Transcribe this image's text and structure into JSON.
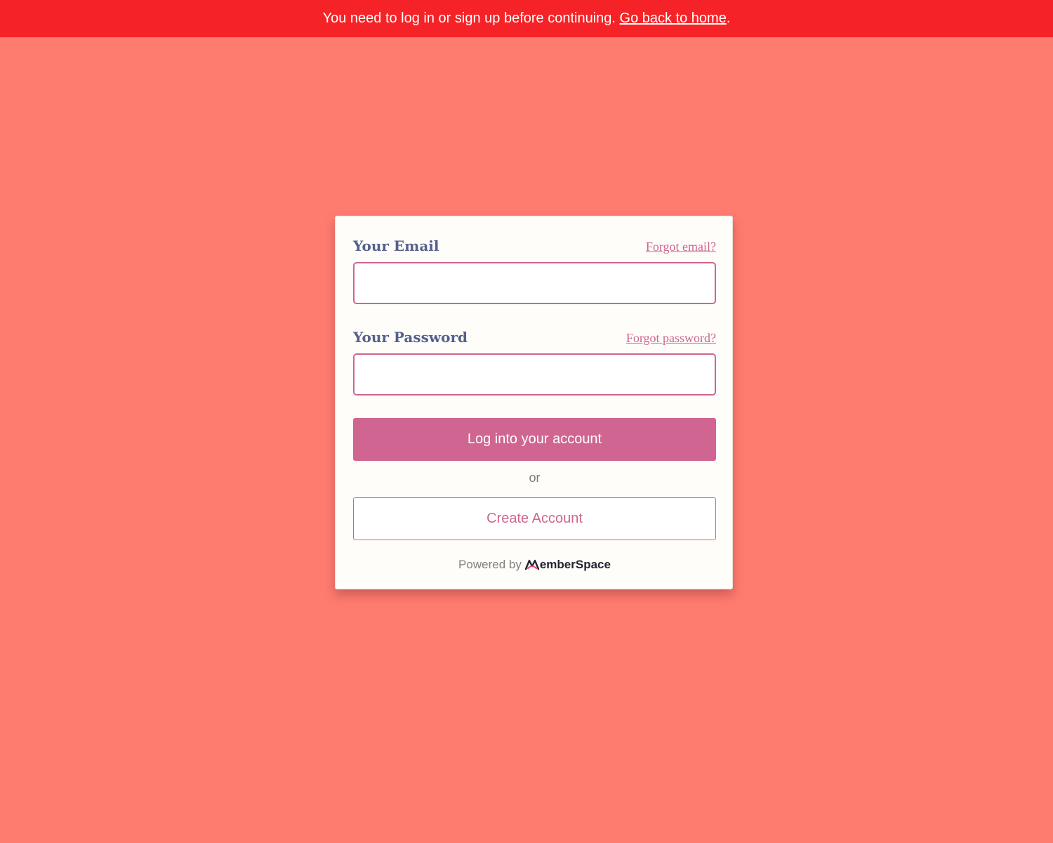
{
  "banner": {
    "message": "You need to log in or sign up before continuing.",
    "link_label": "Go back to home",
    "trailing": "."
  },
  "form": {
    "email": {
      "label": "Your Email",
      "forgot_label": "Forgot email?",
      "value": ""
    },
    "password": {
      "label": "Your Password",
      "forgot_label": "Forgot password?",
      "value": ""
    },
    "login_label": "Log into your account",
    "or_label": "or",
    "create_label": "Create Account"
  },
  "footer": {
    "powered_label": "Powered by",
    "brand_name": "emberSpace",
    "brand_icon": "memberspace-logo-m-icon"
  },
  "colors": {
    "page_background": "#fe7b70",
    "banner_background": "#f52327",
    "accent": "#cf6590",
    "label_text": "#55608c",
    "card_background": "#fefdf9"
  }
}
